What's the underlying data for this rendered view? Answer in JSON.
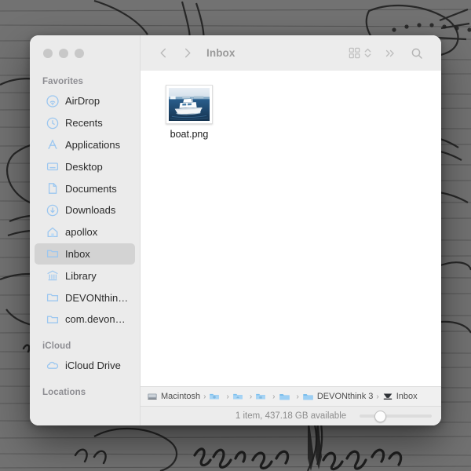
{
  "wallpaper": {
    "description": "vintage-manuscript-engraving",
    "base_color": "#727272",
    "ink_color": "#242424"
  },
  "window": {
    "traffic_lights": [
      {
        "name": "close-button",
        "color": "#c8c8c8"
      },
      {
        "name": "minimize-button",
        "color": "#c8c8c8"
      },
      {
        "name": "zoom-button",
        "color": "#c8c8c8"
      }
    ]
  },
  "toolbar": {
    "back_icon": "chevron-left",
    "forward_icon": "chevron-right",
    "title": "Inbox",
    "view_icon": "grid-view-icon",
    "view_stepper_icon": "chevron-up-down",
    "overflow_label": "»",
    "search_icon": "search-icon"
  },
  "sidebar": {
    "sections": [
      {
        "header": "Favorites",
        "items": [
          {
            "label": "AirDrop",
            "icon": "airdrop-icon",
            "selected": false
          },
          {
            "label": "Recents",
            "icon": "clock-icon",
            "selected": false
          },
          {
            "label": "Applications",
            "icon": "applications-icon",
            "selected": false
          },
          {
            "label": "Desktop",
            "icon": "desktop-icon",
            "selected": false
          },
          {
            "label": "Documents",
            "icon": "document-icon",
            "selected": false
          },
          {
            "label": "Downloads",
            "icon": "downloads-icon",
            "selected": false
          },
          {
            "label": "apollox",
            "icon": "home-icon",
            "selected": false
          },
          {
            "label": "Inbox",
            "icon": "folder-icon",
            "selected": true
          },
          {
            "label": "Library",
            "icon": "library-icon",
            "selected": false
          },
          {
            "label": "DEVONthin…",
            "icon": "folder-icon",
            "selected": false
          },
          {
            "label": "com.devon…",
            "icon": "folder-icon",
            "selected": false
          }
        ]
      },
      {
        "header": "iCloud",
        "items": [
          {
            "label": "iCloud Drive",
            "icon": "cloud-icon",
            "selected": false
          }
        ]
      },
      {
        "header": "Locations",
        "items": []
      }
    ]
  },
  "files": [
    {
      "name": "boat.png",
      "icon": "image-thumbnail-boat",
      "selected": false
    }
  ],
  "path_bar": {
    "nodes": [
      {
        "label": "Macintosh",
        "icon": "hard-disk-icon",
        "truncated": true
      },
      {
        "label": "",
        "icon": "folder-icon"
      },
      {
        "label": "",
        "icon": "folder-icon"
      },
      {
        "label": "",
        "icon": "folder-icon"
      },
      {
        "label": "",
        "icon": "folder-icon"
      },
      {
        "label": "DEVONthink 3",
        "icon": "folder-icon"
      },
      {
        "label": "Inbox",
        "icon": "inbox-tray-icon"
      }
    ],
    "separator": "›"
  },
  "status": {
    "text": "1 item, 437.18 GB available",
    "zoom_slider_value": 27
  },
  "colors": {
    "sidebar_bg": "#ebebeb",
    "toolbar_bg": "#ececec",
    "content_bg": "#ffffff",
    "selection_bg": "#d3d3d3",
    "sidebar_icon_blue": "#9cc7f0"
  }
}
